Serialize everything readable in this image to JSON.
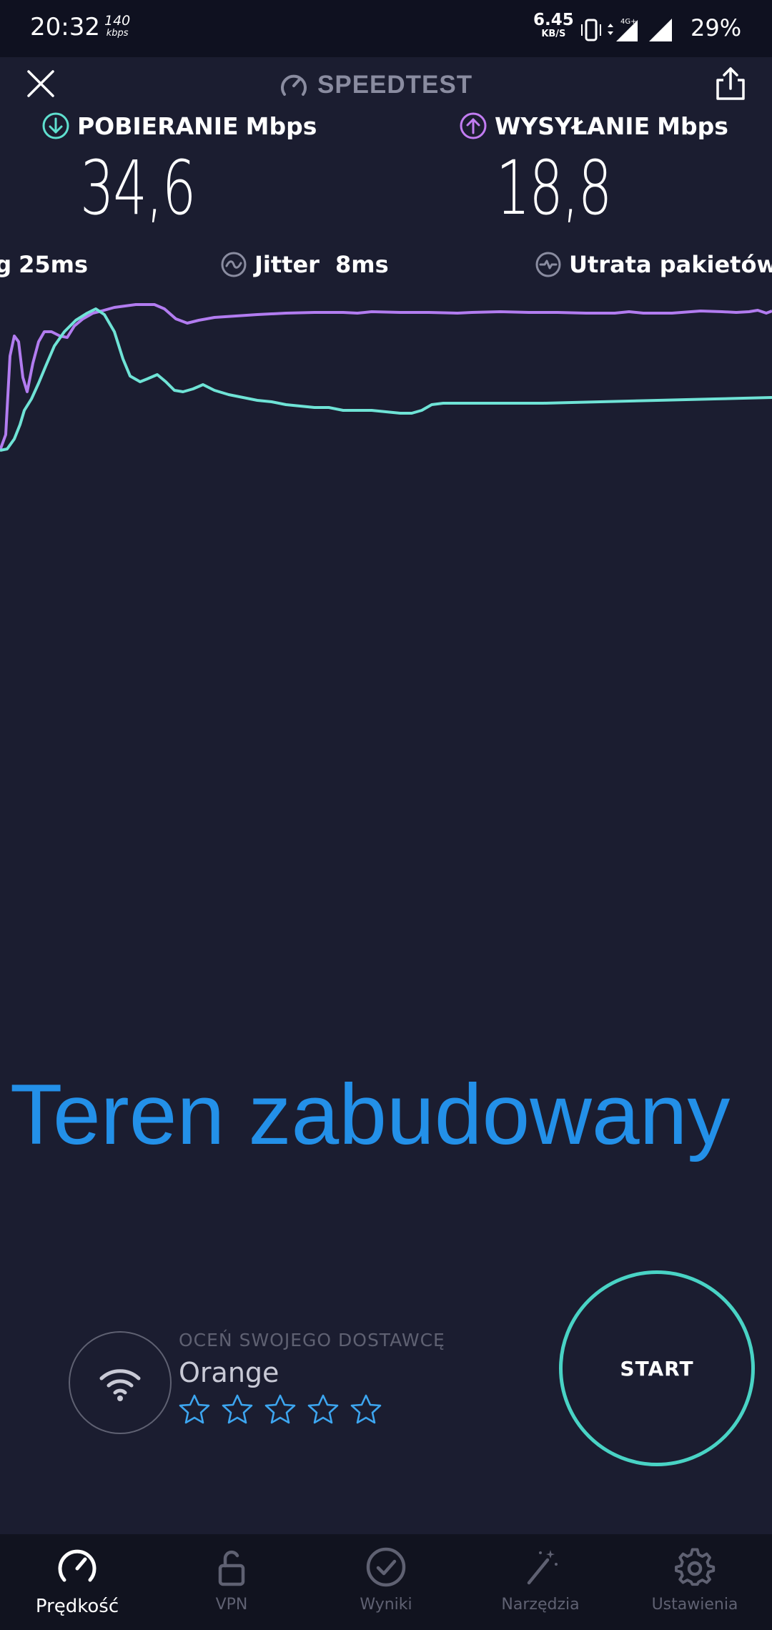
{
  "status_bar": {
    "time": "20:32",
    "speed_value": "140",
    "speed_unit": "kbps",
    "net_value": "6.45",
    "net_unit": "KB/S",
    "network": "4G+",
    "battery": "29%"
  },
  "header": {
    "title": "SPEEDTEST",
    "icons": [
      "close-icon",
      "speedometer-icon",
      "share-icon"
    ]
  },
  "download": {
    "label": "POBIERANIE",
    "unit": "Mbps",
    "value": "34,6",
    "color": "#5fe0cf"
  },
  "upload": {
    "label": "WYSYŁANIE",
    "unit": "Mbps",
    "value": "18,8",
    "color": "#c27cf2"
  },
  "latency": {
    "ping_label": "Ping",
    "ping_value": "25ms",
    "jitter_label": "Jitter",
    "jitter_value": "8ms",
    "loss_label": "Utrata pakietów"
  },
  "graph": {
    "upload_color": "#b27cf0",
    "download_color": "#6fe3d6"
  },
  "overlay": {
    "text": "Teren zabudowany",
    "color": "#2390e8"
  },
  "provider": {
    "rate_label": "OCEŃ SWOJEGO DOSTAWCĘ",
    "name": "Orange",
    "stars_total": 5,
    "stars_filled": 0
  },
  "start_button": {
    "label": "START",
    "color": "#49d3c5"
  },
  "bottom_nav": [
    {
      "label": "Prędkość",
      "icon": "speedometer-icon",
      "active": true
    },
    {
      "label": "VPN",
      "icon": "lock-icon",
      "active": false
    },
    {
      "label": "Wyniki",
      "icon": "check-circle-icon",
      "active": false
    },
    {
      "label": "Narzędzia",
      "icon": "magic-wand-icon",
      "active": false
    },
    {
      "label": "Ustawienia",
      "icon": "gear-icon",
      "active": false
    }
  ]
}
